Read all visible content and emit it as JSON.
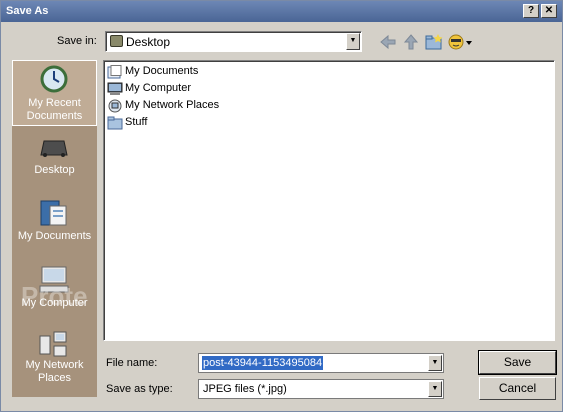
{
  "window": {
    "title": "Save As",
    "help_glyph": "?",
    "close_glyph": "✕"
  },
  "savein": {
    "label": "Save in:",
    "value": "Desktop",
    "arrow": "▼"
  },
  "places": [
    {
      "label": "My Recent Documents",
      "icon": "recent-docs-icon"
    },
    {
      "label": "Desktop",
      "icon": "desktop-icon"
    },
    {
      "label": "My Documents",
      "icon": "my-documents-icon"
    },
    {
      "label": "My Computer",
      "icon": "my-computer-icon"
    },
    {
      "label": "My Network Places",
      "icon": "network-places-icon"
    }
  ],
  "files": [
    {
      "name": "My Documents",
      "icon": "documents-folder-icon"
    },
    {
      "name": "My Computer",
      "icon": "computer-icon"
    },
    {
      "name": "My Network Places",
      "icon": "network-icon"
    },
    {
      "name": "Stuff",
      "icon": "folder-icon"
    }
  ],
  "filename": {
    "label": "File name:",
    "value": "post-43944-1153495084",
    "arrow": "▼"
  },
  "filetype": {
    "label": "Save as type:",
    "value": "JPEG files (*.jpg)",
    "arrow": "▼"
  },
  "buttons": {
    "save": "Save",
    "cancel": "Cancel"
  },
  "watermark": "Prote"
}
